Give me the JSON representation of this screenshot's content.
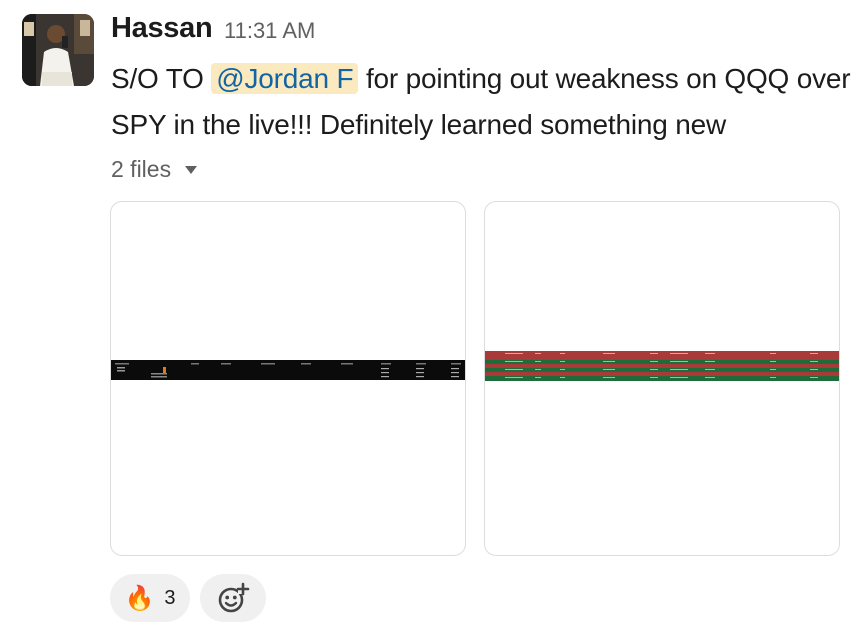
{
  "message": {
    "author": "Hassan",
    "time": "11:31 AM",
    "text_before": "S/O TO ",
    "mention": "@Jordan F",
    "text_after": " for pointing out weakness on QQQ over SPY in the live!!! Definitely learned something new"
  },
  "files": {
    "toggle_label": "2 files",
    "items": [
      {
        "kind": "dark-table-screenshot"
      },
      {
        "kind": "red-green-rows-screenshot"
      }
    ]
  },
  "reactions": [
    {
      "emoji": "🔥",
      "count": "3"
    }
  ],
  "icons": {
    "caret": "chevron-down-icon",
    "add_reaction": "add-reaction-icon"
  },
  "colors": {
    "mention_bg": "#fbe9c0",
    "mention_text": "#1264a3",
    "row_red": "#a83a3a",
    "row_green": "#1f6b3a"
  }
}
